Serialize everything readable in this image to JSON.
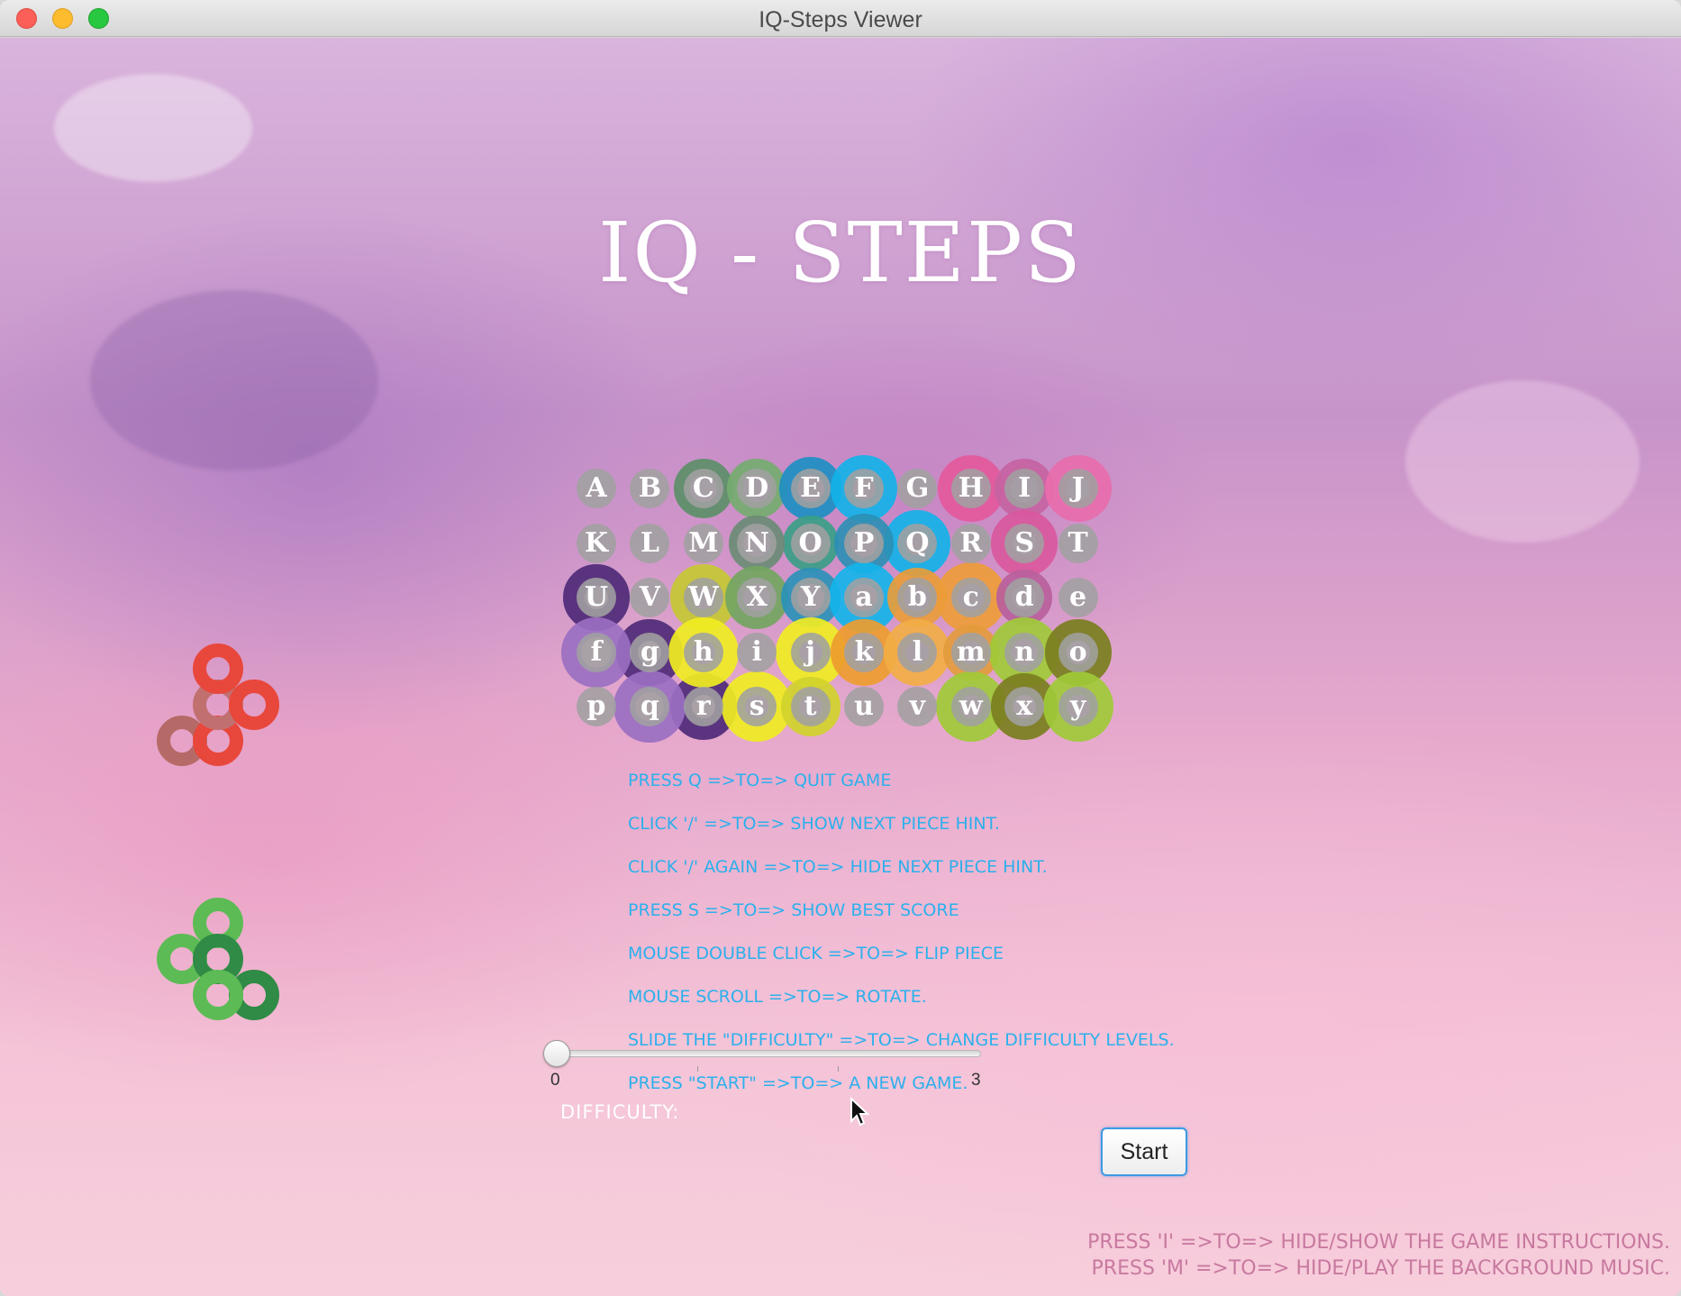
{
  "window": {
    "title": "IQ-Steps Viewer"
  },
  "game": {
    "title": "IQ - STEPS"
  },
  "board": {
    "rows": [
      [
        "A",
        "B",
        "C",
        "D",
        "E",
        "F",
        "G",
        "H",
        "I",
        "J"
      ],
      [
        "K",
        "L",
        "M",
        "N",
        "O",
        "P",
        "Q",
        "R",
        "S",
        "T"
      ],
      [
        "U",
        "V",
        "W",
        "X",
        "Y",
        "a",
        "b",
        "c",
        "d",
        "e"
      ],
      [
        "f",
        "g",
        "h",
        "i",
        "j",
        "k",
        "l",
        "m",
        "n",
        "o"
      ],
      [
        "p",
        "q",
        "r",
        "s",
        "t",
        "u",
        "v",
        "w",
        "x",
        "y"
      ]
    ]
  },
  "pieces": {
    "side_red": {
      "color": "#e8473b",
      "icon": "red-tripod-piece"
    },
    "side_green": {
      "color": "#5dbb55",
      "icon": "green-tripod-piece"
    }
  },
  "instructions": [
    "PRESS Q =>TO=> QUIT GAME",
    "CLICK '/' =>TO=> SHOW NEXT PIECE HINT.",
    "CLICK '/' AGAIN =>TO=> HIDE NEXT PIECE HINT.",
    "PRESS S =>TO=> SHOW BEST SCORE",
    "MOUSE DOUBLE CLICK =>TO=> FLIP PIECE",
    "MOUSE SCROLL =>TO=> ROTATE.",
    "SLIDE THE \"DIFFICULTY\" =>TO=> CHANGE DIFFICULTY LEVELS.",
    "PRESS \"START\" =>TO=> A NEW GAME."
  ],
  "difficulty": {
    "label": "DIFFICULTY:",
    "min_label": "0",
    "max_label": "3",
    "value": 0,
    "max": 3
  },
  "start_button": {
    "label": "Start"
  },
  "footer": {
    "hint_instructions": "PRESS 'I' =>TO=> HIDE/SHOW THE GAME INSTRUCTIONS.",
    "hint_music": "PRESS 'M' =>TO=> HIDE/PLAY THE BACKGROUND MUSIC."
  },
  "colors": {
    "instruction_text": "#2cb0ec",
    "footer_text": "#c8799f",
    "accent_button": "#3d9ae3"
  }
}
